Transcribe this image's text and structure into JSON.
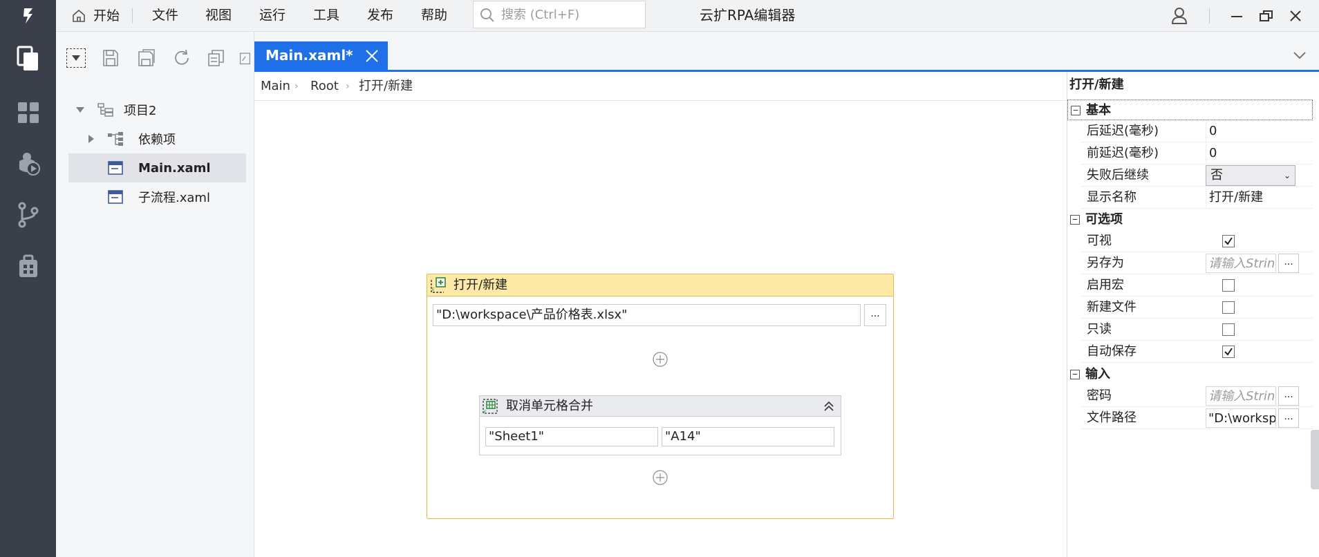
{
  "app": {
    "title": "云扩RPA编辑器"
  },
  "menu": {
    "home": "开始",
    "items": [
      "文件",
      "视图",
      "运行",
      "工具",
      "发布",
      "帮助"
    ]
  },
  "search": {
    "placeholder": "搜索 (Ctrl+F)"
  },
  "project": {
    "tree": [
      {
        "label": "项目2"
      },
      {
        "label": "依赖项"
      },
      {
        "label": "Main.xaml"
      },
      {
        "label": "子流程.xaml"
      }
    ]
  },
  "editor": {
    "tab": {
      "label": "Main.xaml*"
    },
    "breadcrumb": [
      "Main",
      "Root",
      "打开/新建"
    ]
  },
  "activities": {
    "open": {
      "title": "打开/新建",
      "path": "\"D:\\workspace\\产品价格表.xlsx\"",
      "browse": "..."
    },
    "unmerge": {
      "title": "取消单元格合并",
      "sheet": "\"Sheet1\"",
      "range": "\"A14\""
    }
  },
  "properties": {
    "title": "打开/新建",
    "groups": {
      "basic": {
        "label": "基本",
        "after_delay_label": "后延迟(毫秒)",
        "after_delay": "0",
        "before_delay_label": "前延迟(毫秒)",
        "before_delay": "0",
        "continue_on_error_label": "失败后继续",
        "continue_on_error": "否",
        "display_name_label": "显示名称",
        "display_name": "打开/新建"
      },
      "optional": {
        "label": "可选项",
        "visible_label": "可视",
        "visible": true,
        "save_as_label": "另存为",
        "save_as_placeholder": "请输入String",
        "enable_macro_label": "启用宏",
        "enable_macro": false,
        "new_file_label": "新建文件",
        "new_file": false,
        "readonly_label": "只读",
        "readonly": false,
        "autosave_label": "自动保存",
        "autosave": true
      },
      "input": {
        "label": "输入",
        "password_label": "密码",
        "password_placeholder": "请输入String",
        "file_path_label": "文件路径",
        "file_path": "\"D:\\workspace\\产品价格表.xlsx\""
      }
    },
    "dots": "..."
  },
  "colors": {
    "sidebar": "#3b3f4a",
    "accent": "#1e6fe8",
    "activity_header": "#fee9a6",
    "activity_border": "#e5b94a"
  }
}
